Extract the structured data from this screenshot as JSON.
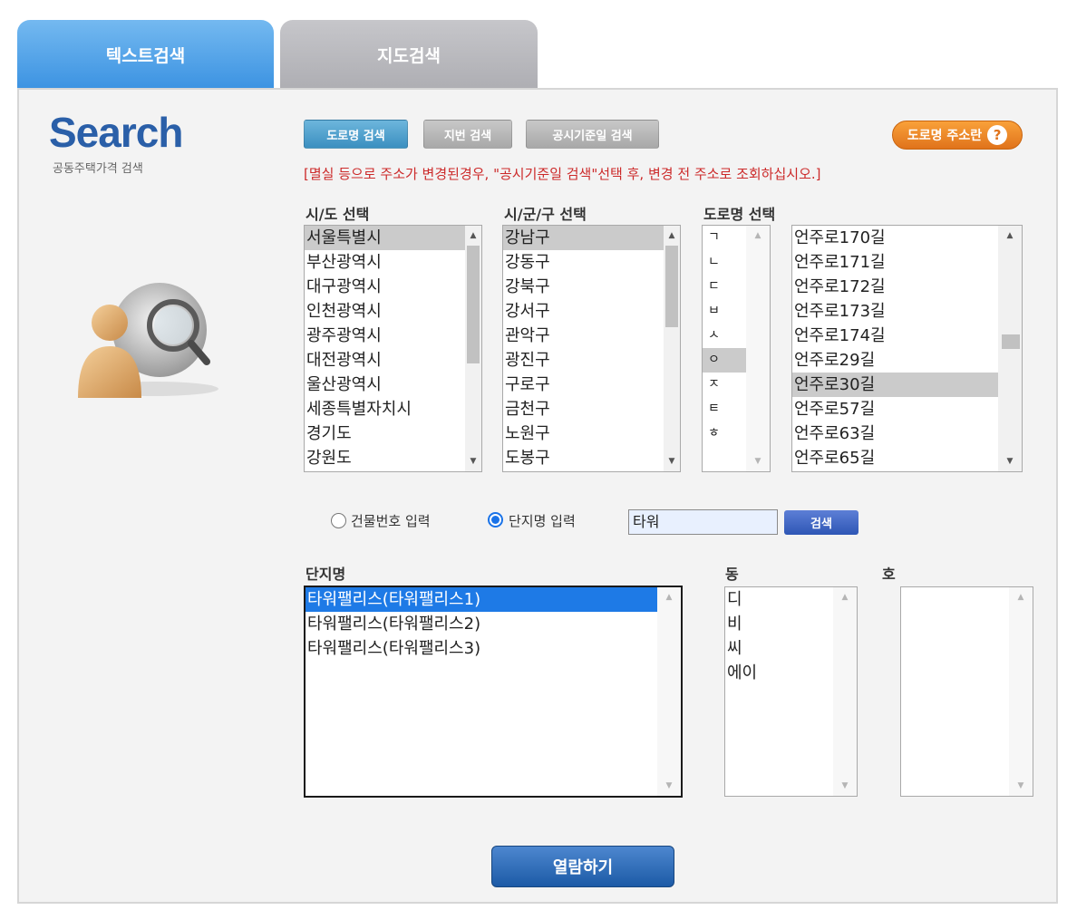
{
  "tabs": [
    {
      "label": "텍스트검색",
      "active": true
    },
    {
      "label": "지도검색",
      "active": false
    }
  ],
  "logo": {
    "title": "Search",
    "subtitle": "공동주택가격 검색"
  },
  "search_modes": {
    "road": "도로명 검색",
    "lot": "지번 검색",
    "date": "공시기준일 검색"
  },
  "guide_button": {
    "label": "도로명 주소란",
    "icon": "question-icon"
  },
  "notice": "[멸실 등으로 주소가 변경된경우, \"공시기준일 검색\"선택 후, 변경 전 주소로 조회하십시오.]",
  "sido": {
    "label": "시/도 선택",
    "items": [
      "서울특별시",
      "부산광역시",
      "대구광역시",
      "인천광역시",
      "광주광역시",
      "대전광역시",
      "울산광역시",
      "세종특별자치시",
      "경기도",
      "강원도"
    ],
    "selected": 0
  },
  "sigungu": {
    "label": "시/군/구 선택",
    "items": [
      "강남구",
      "강동구",
      "강북구",
      "강서구",
      "관악구",
      "광진구",
      "구로구",
      "금천구",
      "노원구",
      "도봉구"
    ],
    "selected": 0
  },
  "road": {
    "label": "도로명 선택",
    "initials": [
      "ㄱ",
      "ㄴ",
      "ㄷ",
      "ㅂ",
      "ㅅ",
      "ㅇ",
      "ㅈ",
      "ㅌ",
      "ㅎ"
    ],
    "initial_selected": 5,
    "items": [
      "언주로170길",
      "언주로171길",
      "언주로172길",
      "언주로173길",
      "언주로174길",
      "언주로29길",
      "언주로30길",
      "언주로57길",
      "언주로63길",
      "언주로65길"
    ],
    "selected": 6
  },
  "input_mode": {
    "building_label": "건물번호 입력",
    "complex_label": "단지명 입력",
    "selected": "complex"
  },
  "search": {
    "value": "타워",
    "button_label": "검색"
  },
  "complex": {
    "label": "단지명",
    "items": [
      "타워팰리스(타워팰리스1)",
      "타워팰리스(타워팰리스2)",
      "타워팰리스(타워팰리스3)"
    ],
    "selected": 0
  },
  "dong": {
    "label": "동",
    "items": [
      "디",
      "비",
      "씨",
      "에이"
    ]
  },
  "ho": {
    "label": "호",
    "items": []
  },
  "view_button": {
    "label": "열람하기"
  }
}
